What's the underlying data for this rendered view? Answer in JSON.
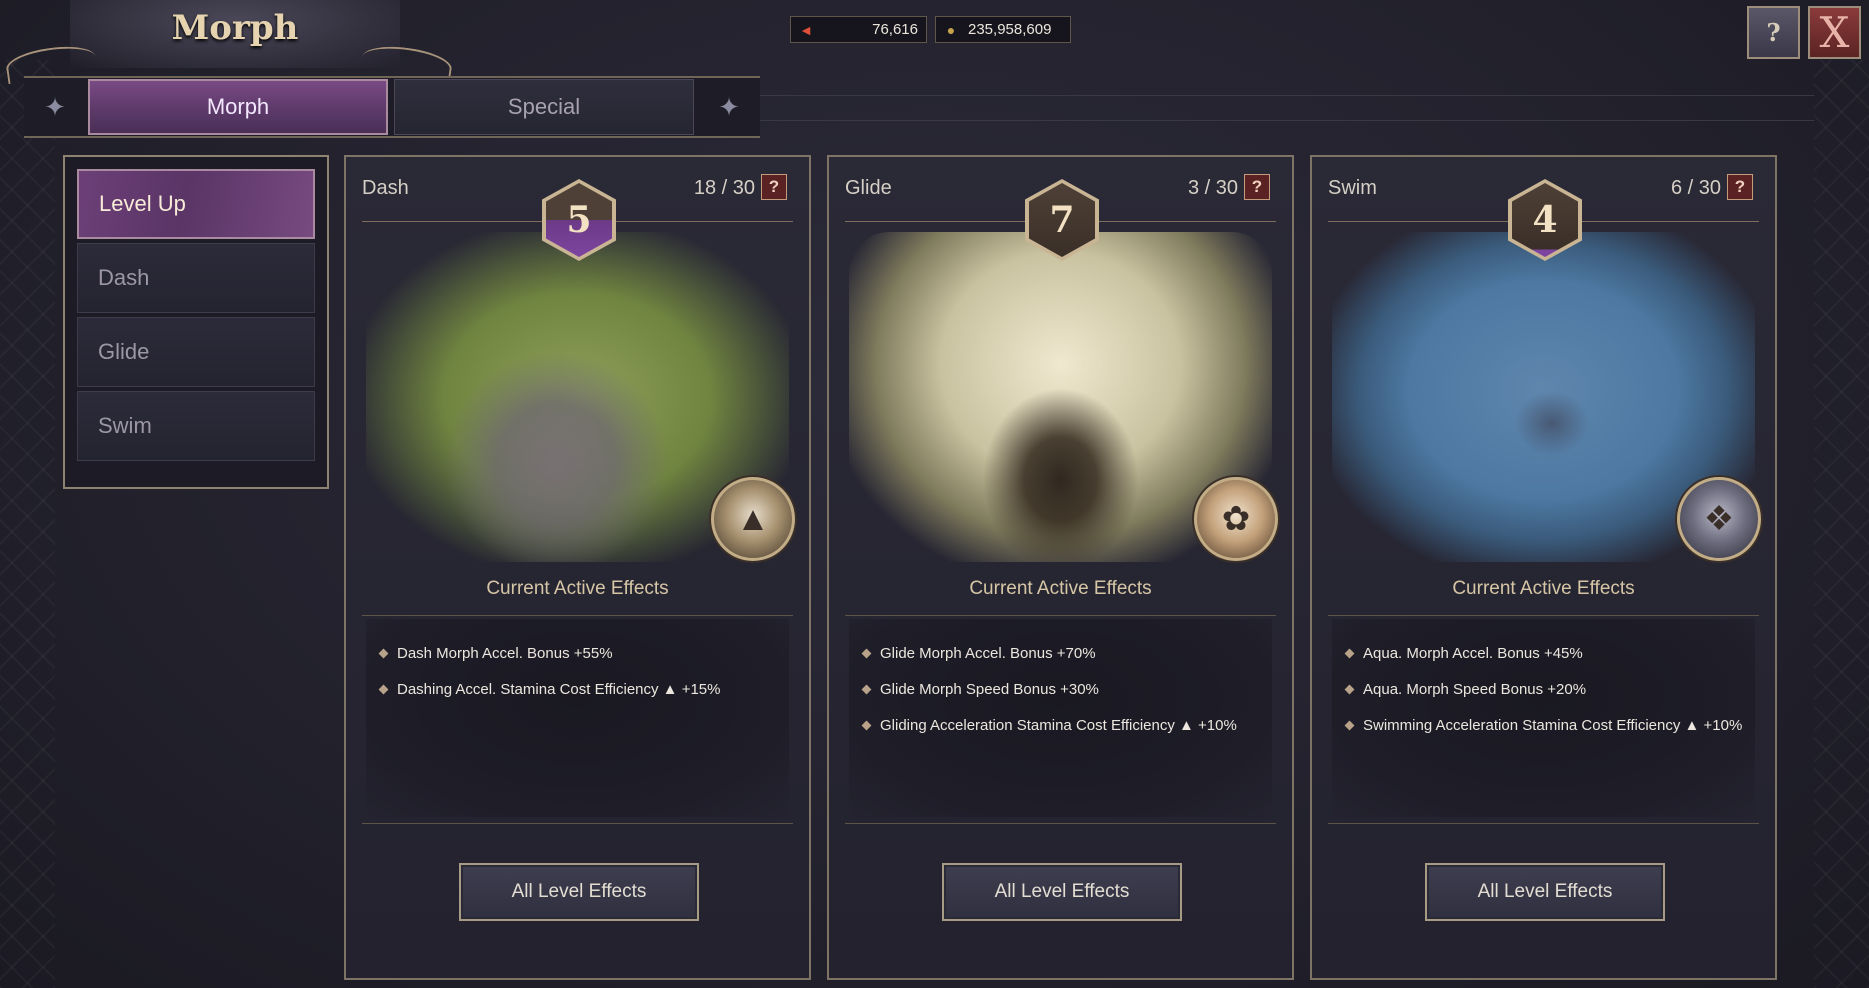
{
  "window": {
    "title": "Morph",
    "help_icon": "help-book-icon",
    "close_icon": "close-x-icon"
  },
  "currencies": [
    {
      "icon": "ticket-icon",
      "value": "76,616"
    },
    {
      "icon": "coin-icon",
      "value": "235,958,609"
    }
  ],
  "tabs": [
    {
      "label": "Morph",
      "active": true
    },
    {
      "label": "Special",
      "active": false
    }
  ],
  "sidebar": {
    "items": [
      {
        "label": "Level Up",
        "active": true
      },
      {
        "label": "Dash",
        "active": false
      },
      {
        "label": "Glide",
        "active": false
      },
      {
        "label": "Swim",
        "active": false
      }
    ]
  },
  "cards": [
    {
      "name": "Dash",
      "level": "5",
      "progress": "18 / 30",
      "effects_title": "Current Active Effects",
      "effects": [
        "Dash Morph Accel. Bonus +55%",
        "Dashing Accel. Stamina Cost Efficiency ▲ +15%"
      ],
      "button": "All Level Effects",
      "portrait": "deer-portrait-icon"
    },
    {
      "name": "Glide",
      "level": "7",
      "progress": "3 / 30",
      "effects_title": "Current Active Effects",
      "effects": [
        "Glide Morph Accel. Bonus +70%",
        "Glide Morph Speed Bonus  +30%",
        "Gliding Acceleration Stamina Cost Efficiency ▲ +10%"
      ],
      "button": "All Level Effects",
      "portrait": "rabbit-portrait-icon"
    },
    {
      "name": "Swim",
      "level": "4",
      "progress": "6 / 30",
      "effects_title": "Current Active Effects",
      "effects": [
        "Aqua. Morph Accel. Bonus +45%",
        "Aqua. Morph Speed Bonus +20%",
        "Swimming Acceleration Stamina Cost Efficiency ▲ +10%"
      ],
      "button": "All Level Effects",
      "portrait": "dragon-portrait-icon"
    }
  ],
  "colors": {
    "accent_purple": "#6c3f78",
    "gold_text": "#e6d3b0",
    "frame": "#8e8270"
  }
}
